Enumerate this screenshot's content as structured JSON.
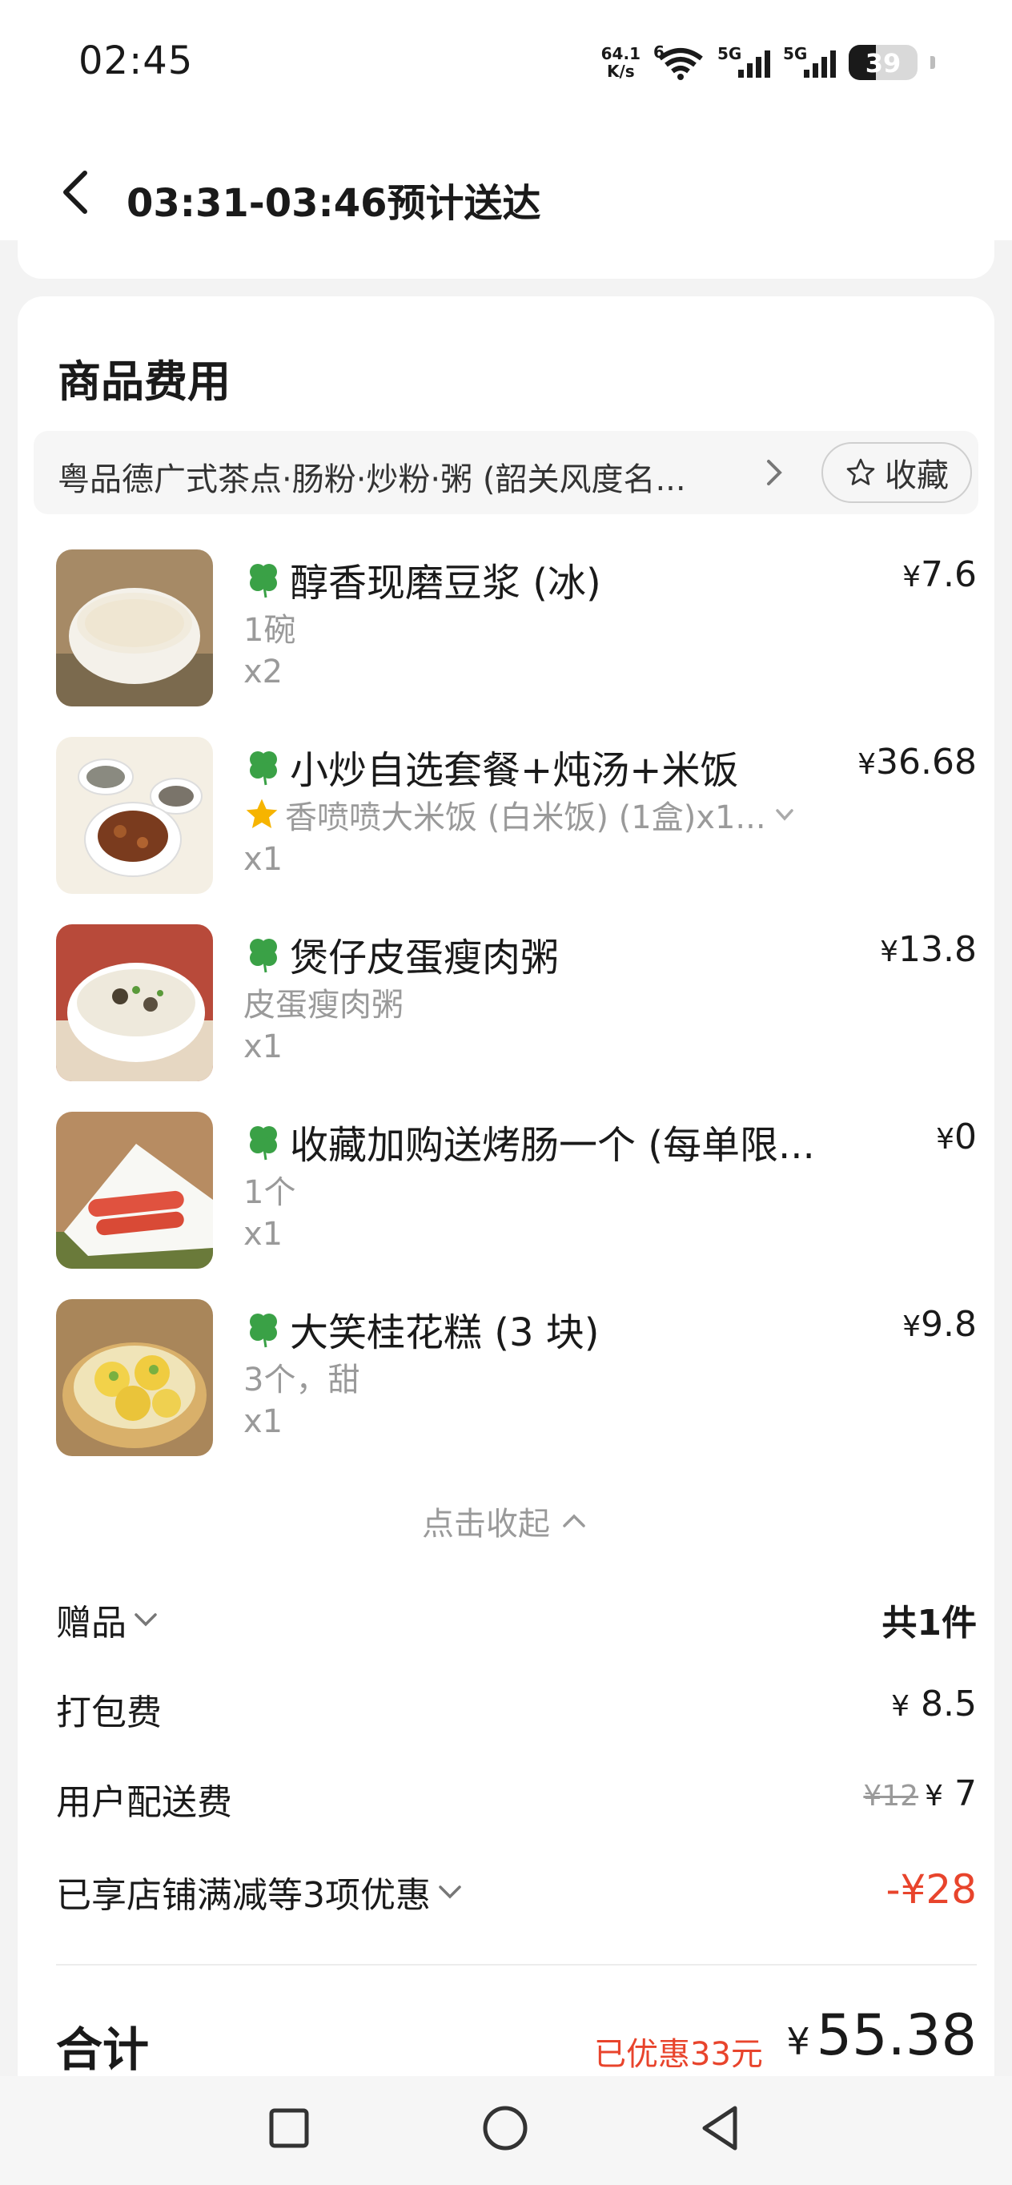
{
  "status_bar": {
    "time": "02:45",
    "net_speed_value": "64.1",
    "net_speed_unit": "K/s",
    "wifi_tag": "6",
    "sim1_tag": "5G",
    "sim2_tag": "5G",
    "battery": "39"
  },
  "header": {
    "title": "03:31-03:46预计送达"
  },
  "section": {
    "title": "商品费用"
  },
  "shop": {
    "name": "粤品德广式茶点·肠粉·炒粉·粥 (韶关风度名...",
    "favorite_label": "收藏"
  },
  "items": [
    {
      "name": "醇香现磨豆浆 (冰)",
      "spec": "1碗",
      "qty": "x2",
      "price": "7.6"
    },
    {
      "name": "小炒自选套餐+炖汤+米饭",
      "spec": "香喷喷大米饭 (白米饭) (1盒)x1...",
      "qty": "x1",
      "price": "36.68"
    },
    {
      "name": "煲仔皮蛋瘦肉粥",
      "spec": "皮蛋瘦肉粥",
      "qty": "x1",
      "price": "13.8"
    },
    {
      "name": "收藏加购送烤肠一个 (每单限...",
      "spec": "1个",
      "qty": "x1",
      "price": "0"
    },
    {
      "name": "大笑桂花糕 (3 块)",
      "spec": "3个，甜",
      "qty": "x1",
      "price": "9.8"
    }
  ],
  "currency": "¥",
  "collapse_label": "点击收起",
  "fees": {
    "gift_label": "赠品",
    "gift_value": "共1件",
    "packing_label": "打包费",
    "packing_value": "8.5",
    "delivery_label": "用户配送费",
    "delivery_original": "¥12",
    "delivery_value": "7",
    "discount_label": "已享店铺满减等3项优惠",
    "discount_value": "-¥28"
  },
  "total": {
    "label": "合计",
    "saved": "已优惠33元",
    "value": "55.38"
  },
  "colors": {
    "accent_red": "#e8442c",
    "card_bg": "#ffffff",
    "page_bg": "#f3f3f3",
    "clover_green": "#3aa146",
    "star_yellow": "#f6b400"
  }
}
